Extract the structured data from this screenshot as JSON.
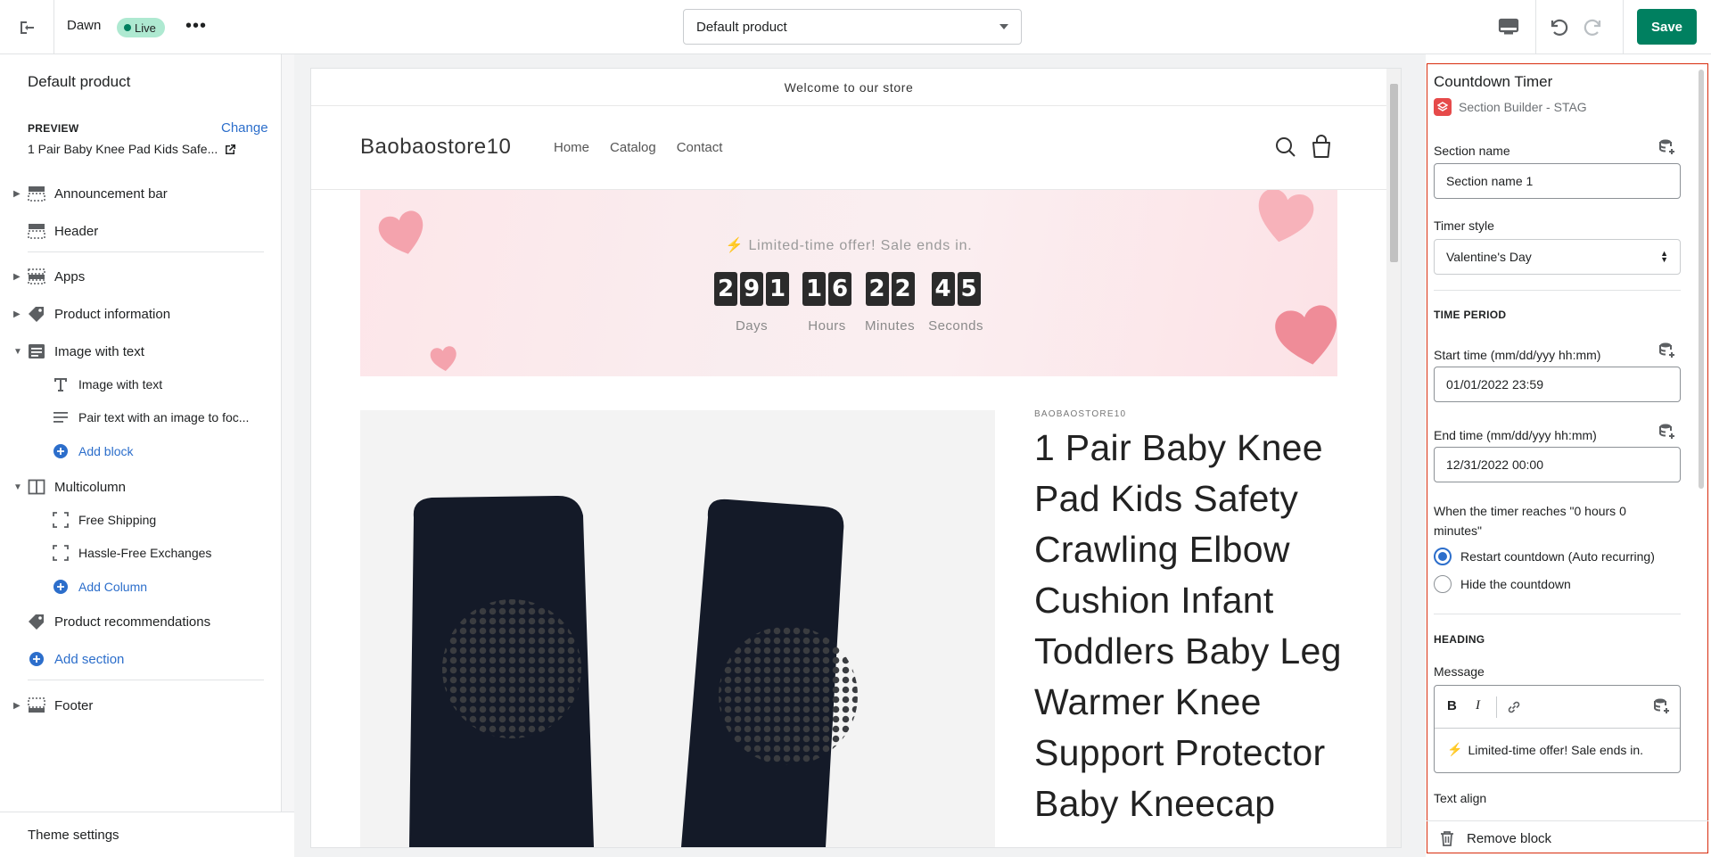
{
  "topbar": {
    "theme_name": "Dawn",
    "live_badge": "Live",
    "more_label": "•••",
    "template_select": "Default product",
    "save_label": "Save"
  },
  "sidebar": {
    "title": "Default product",
    "preview_label": "PREVIEW",
    "change_link": "Change",
    "preview_value": "1 Pair Baby Knee Pad Kids Safe...",
    "items": [
      {
        "label": "Announcement bar",
        "icon": "announcement-bar-icon",
        "expandable": true
      },
      {
        "label": "Header",
        "icon": "header-icon",
        "expandable": false
      },
      {
        "label": "Apps",
        "icon": "apps-icon",
        "expandable": true
      },
      {
        "label": "Product information",
        "icon": "tag-icon",
        "expandable": true
      },
      {
        "label": "Image with text",
        "icon": "image-with-text-icon",
        "expandable": true,
        "expanded": true
      },
      {
        "label": "Image with text",
        "icon": "text-icon",
        "sub": true
      },
      {
        "label": "Pair text with an image to foc...",
        "icon": "paragraph-icon",
        "sub": true
      },
      {
        "label": "Add block",
        "icon": "add-circle-icon",
        "sub": true,
        "link": true
      },
      {
        "label": "Multicolumn",
        "icon": "columns-icon",
        "expandable": true,
        "expanded": true
      },
      {
        "label": "Free Shipping",
        "icon": "column-block-icon",
        "sub": true
      },
      {
        "label": "Hassle-Free Exchanges",
        "icon": "column-block-icon",
        "sub": true
      },
      {
        "label": "Add Column",
        "icon": "add-circle-icon",
        "sub": true,
        "link": true
      },
      {
        "label": "Product recommendations",
        "icon": "tag-icon",
        "expandable": false
      },
      {
        "label": "Add section",
        "icon": "add-circle-icon",
        "link": true
      },
      {
        "label": "Footer",
        "icon": "footer-icon",
        "expandable": true
      }
    ],
    "theme_settings": "Theme settings"
  },
  "preview": {
    "announcement": "Welcome to our store",
    "store_name": "Baobaostore10",
    "nav": [
      "Home",
      "Catalog",
      "Contact"
    ],
    "banner_message": "Limited-time offer! Sale ends in.",
    "timer": [
      {
        "digits": [
          "2",
          "9",
          "1"
        ],
        "label": "Days"
      },
      {
        "digits": [
          "1",
          "6"
        ],
        "label": "Hours"
      },
      {
        "digits": [
          "2",
          "2"
        ],
        "label": "Minutes"
      },
      {
        "digits": [
          "4",
          "5"
        ],
        "label": "Seconds"
      }
    ],
    "vendor": "BAOBAOSTORE10",
    "product_title": "1 Pair Baby Knee Pad Kids Safety Crawling Elbow Cushion Infant Toddlers Baby Leg Warmer Knee Support Protector Baby Kneecap"
  },
  "panel": {
    "title": "Countdown Timer",
    "app_name": "Section Builder - STAG",
    "section_name_label": "Section name",
    "section_name_value": "Section name 1",
    "timer_style_label": "Timer style",
    "timer_style_value": "Valentine's Day",
    "time_period_heading": "TIME PERIOD",
    "start_time_label": "Start time (mm/dd/yyy hh:mm)",
    "start_time_value": "01/01/2022 23:59",
    "end_time_label": "End time (mm/dd/yyy hh:mm)",
    "end_time_value": "12/31/2022 00:00",
    "when_label": "When the timer reaches \"0 hours 0 minutes\"",
    "radio_restart": "Restart countdown (Auto recurring)",
    "radio_hide": "Hide the countdown",
    "heading_heading": "HEADING",
    "message_label": "Message",
    "message_value": "Limited-time offer! Sale ends in.",
    "text_align_label": "Text align",
    "remove_block": "Remove block"
  },
  "colors": {
    "primary": "#008060",
    "link": "#2c6ecb",
    "live_badge": "#aee9d1",
    "selection_border": "#d82c0d"
  }
}
